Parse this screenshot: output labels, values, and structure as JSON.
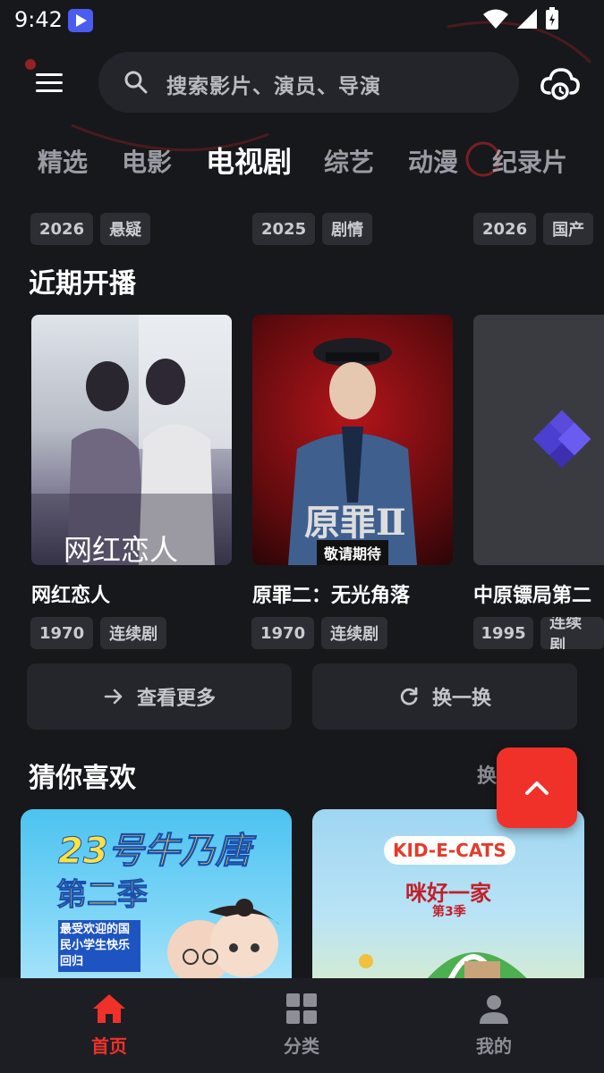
{
  "status_bar": {
    "time": "9:42"
  },
  "search": {
    "placeholder": "搜索影片、演员、导演"
  },
  "tabs": [
    "精选",
    "电影",
    "电视剧",
    "综艺",
    "动漫",
    "纪录片"
  ],
  "active_tab_index": 2,
  "clipped_row": [
    {
      "tags": [
        "2026",
        "悬疑"
      ]
    },
    {
      "tags": [
        "2025",
        "剧情"
      ]
    },
    {
      "tags": [
        "2026",
        "国产"
      ]
    }
  ],
  "upcoming": {
    "title": "近期开播",
    "items": [
      {
        "title": "网红恋人",
        "year": "1970",
        "genre": "连续剧",
        "poster_caption": "网红恋人"
      },
      {
        "title": "原罪二：无光角落",
        "year": "1970",
        "genre": "连续剧",
        "poster_caption": "原罪Ⅱ",
        "poster_badge": "敬请期待"
      },
      {
        "title": "中原镖局第二",
        "year": "1995",
        "genre": "连续剧"
      }
    ],
    "more_button": "查看更多",
    "refresh_button": "换一换"
  },
  "guess": {
    "title": "猜你喜欢",
    "refresh_link": "换",
    "items": [
      {
        "poster_title": "23号牛乃唐",
        "poster_subtitle": "第二季",
        "poster_text": "最受欢迎的国民小学生快乐回归"
      },
      {
        "poster_title": "KID-E-CATS",
        "poster_subtitle": "咪好一家",
        "poster_season": "第3季"
      }
    ]
  },
  "bottom_nav": [
    {
      "label": "首页",
      "icon": "home-icon",
      "active": true
    },
    {
      "label": "分类",
      "icon": "grid-icon",
      "active": false
    },
    {
      "label": "我的",
      "icon": "user-icon",
      "active": false
    }
  ],
  "colors": {
    "accent": "#f0312a",
    "background": "#17181c",
    "tag_bg": "#2c2e34"
  }
}
